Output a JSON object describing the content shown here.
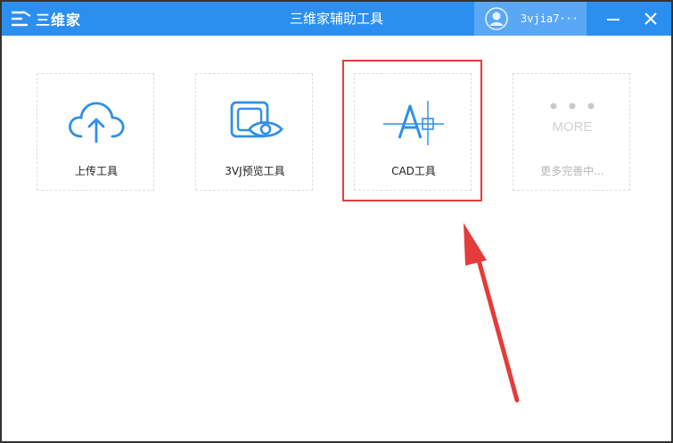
{
  "app": {
    "logo_text": "三维家",
    "title": "三维家辅助工具",
    "user_name": "3vjia7···"
  },
  "tools": [
    {
      "label": "上传工具",
      "icon": "cloud-upload-icon",
      "enabled": true
    },
    {
      "label": "3VJ预览工具",
      "icon": "eye-preview-icon",
      "enabled": true
    },
    {
      "label": "CAD工具",
      "icon": "cad-icon",
      "enabled": true,
      "highlighted": true
    },
    {
      "label": "更多完善中...",
      "icon": "more-icon",
      "icon_text": "MORE",
      "enabled": false
    }
  ],
  "colors": {
    "titlebar": "#2c8ff0",
    "user_area": "#5aa8f5",
    "accent_icon": "#2f8fe8",
    "disabled": "#c9c9c9",
    "highlight": "#e43b3b"
  }
}
